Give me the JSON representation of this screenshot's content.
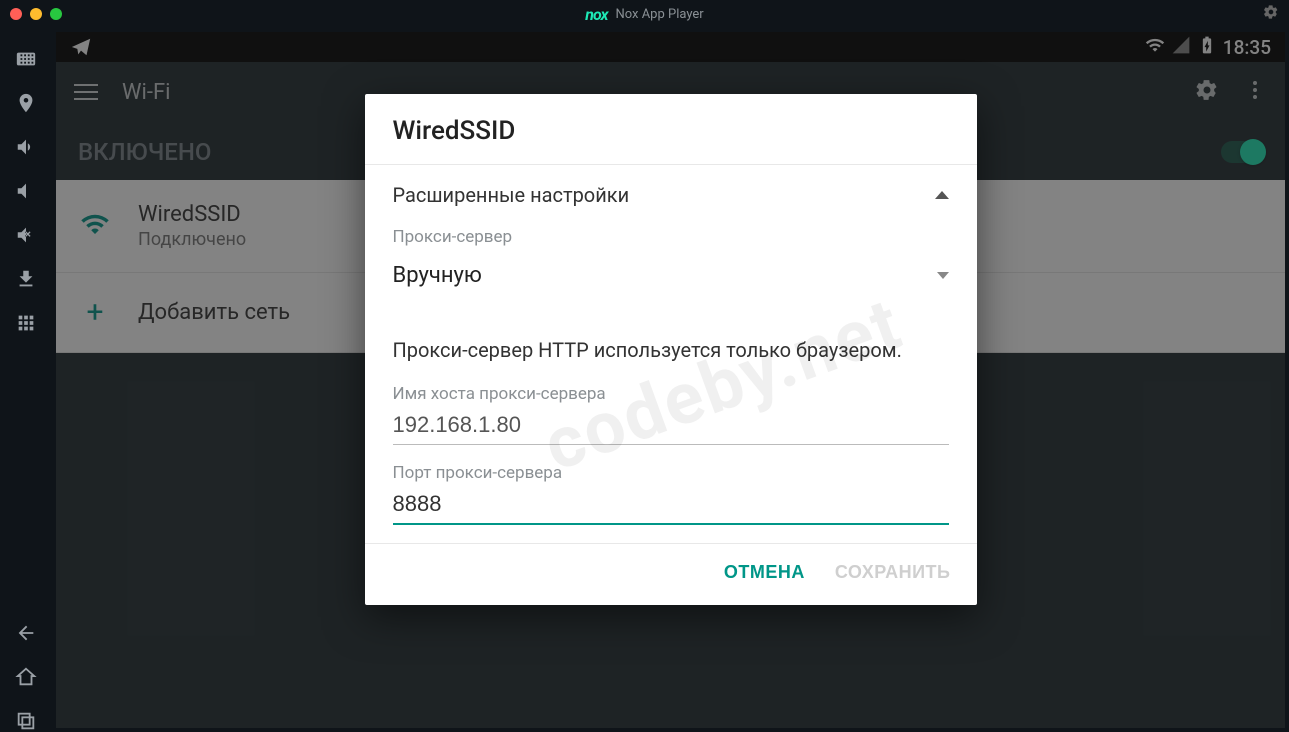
{
  "window": {
    "title": "Nox App Player",
    "logo_text": "nox"
  },
  "status": {
    "time": "18:35"
  },
  "app": {
    "title": "Wi-Fi",
    "enabled_label": "ВКЛЮЧЕНО"
  },
  "wifi": {
    "items": [
      {
        "name": "WiredSSID",
        "status": "Подключено"
      }
    ],
    "add_label": "Добавить сеть"
  },
  "dialog": {
    "title": "WiredSSID",
    "advanced_label": "Расширенные настройки",
    "proxy_label": "Прокси-сервер",
    "proxy_value": "Вручную",
    "info_text": "Прокси-сервер HTTP используется только браузером.",
    "hostname_label": "Имя хоста прокси-сервера",
    "hostname_value": "192.168.1.80",
    "port_label": "Порт прокси-сервера",
    "port_value": "8888",
    "cancel": "ОТМЕНА",
    "save": "СОХРАНИТЬ"
  },
  "watermark": "codeby.net"
}
